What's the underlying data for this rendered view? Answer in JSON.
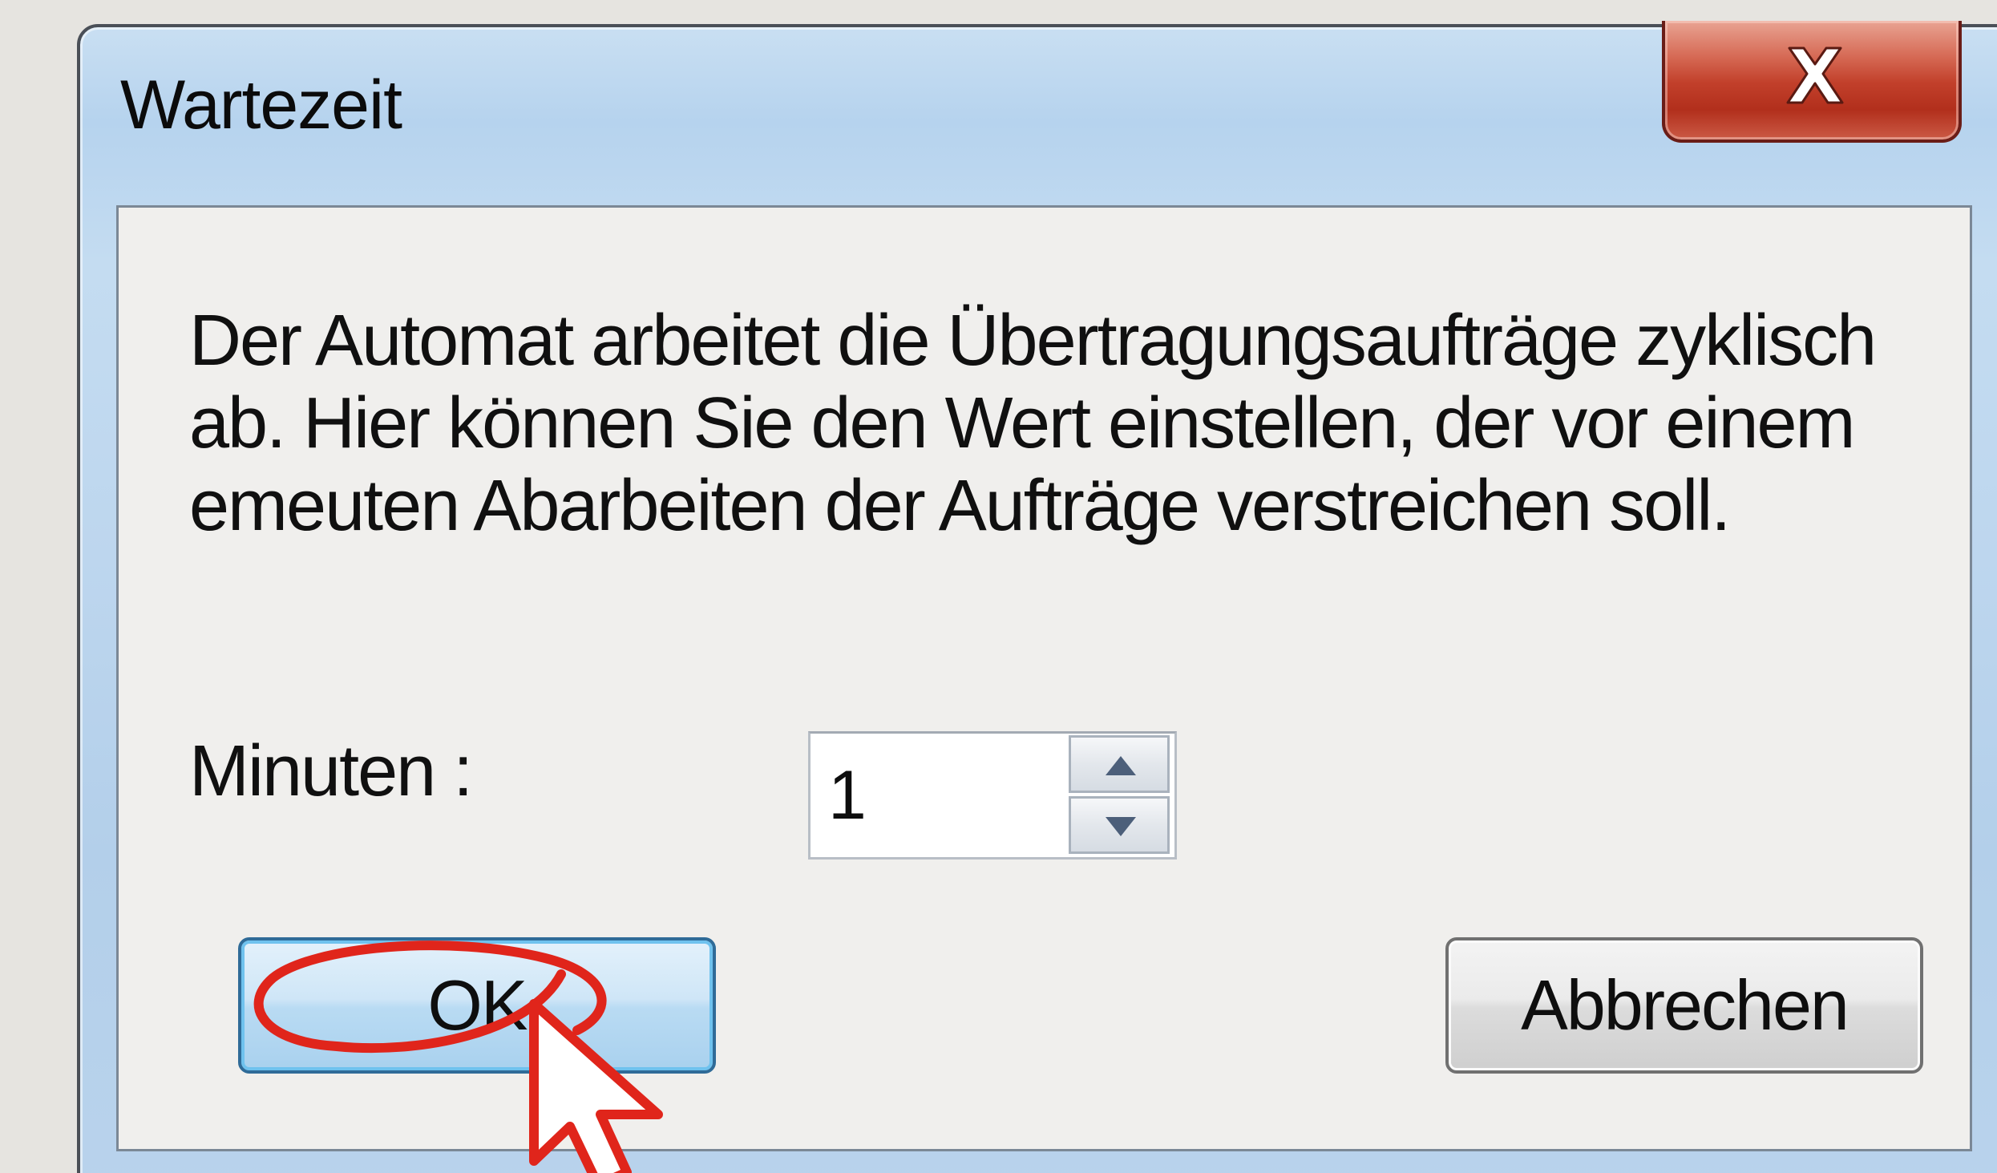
{
  "window": {
    "title": "Wartezeit",
    "close_label": "X"
  },
  "body": {
    "description": "Der Automat arbeitet die Übertragungsaufträge zyklisch\nab. Hier können Sie den Wert einstellen, der vor einem\nemeuten Abarbeiten der Aufträge verstreichen soll.",
    "minutes_label": "Minuten :",
    "minutes_value": "1"
  },
  "buttons": {
    "ok_label": "OK",
    "cancel_label": "Abbrechen"
  },
  "annotation": {
    "highlight_color": "#e0251b"
  }
}
